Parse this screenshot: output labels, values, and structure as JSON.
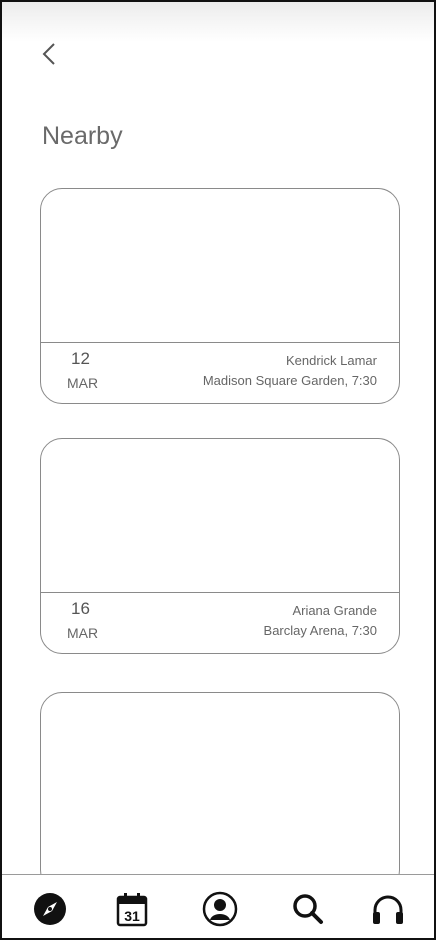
{
  "header": {
    "back_icon": "chevron-left-icon",
    "title": "Nearby"
  },
  "events": [
    {
      "day": "12",
      "month": "MAR",
      "artist": "Kendrick Lamar",
      "venue": "Madison Square Garden, 7:30"
    },
    {
      "day": "16",
      "month": "MAR",
      "artist": "Ariana Grande",
      "venue": "Barclay Arena, 7:30"
    }
  ],
  "tabbar": {
    "items": [
      {
        "icon": "compass-icon"
      },
      {
        "icon": "calendar-icon",
        "label": "31"
      },
      {
        "icon": "profile-icon"
      },
      {
        "icon": "search-icon"
      },
      {
        "icon": "headphones-icon"
      }
    ]
  }
}
